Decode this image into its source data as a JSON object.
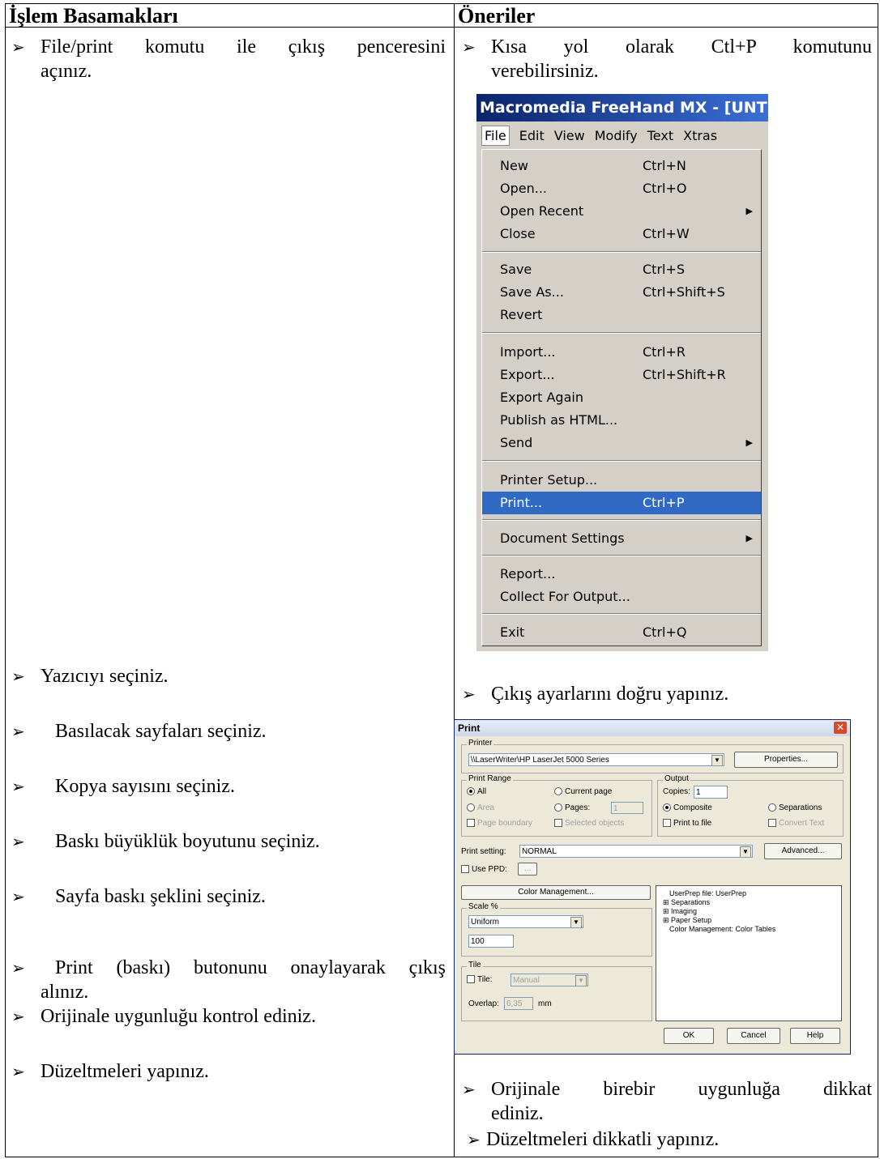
{
  "headers": {
    "left": "İşlem Basamakları",
    "right": "Öneriler"
  },
  "bullet_glyph": "➢",
  "left_steps": [
    {
      "line1": "File/print komutu ile çıkış penceresini",
      "line2": "açınız."
    },
    {
      "line1": "Yazıcıyı seçiniz."
    },
    {
      "line1": "Basılacak sayfaları seçiniz."
    },
    {
      "line1": "Kopya sayısını seçiniz."
    },
    {
      "line1": "Baskı büyüklük boyutunu seçiniz."
    },
    {
      "line1": "Sayfa baskı şeklini seçiniz."
    },
    {
      "line1": "Print (baskı) butonunu onaylayarak çıkış",
      "line2": "alınız."
    },
    {
      "line1": "Orijinale uygunluğu kontrol ediniz."
    },
    {
      "line1": "Düzeltmeleri yapınız."
    }
  ],
  "right_notes": [
    {
      "line1": "Kısa yol olarak Ctl+P komutunu",
      "line2": "verebilirsiniz."
    },
    {
      "line1": "Çıkış ayarlarını doğru yapınız."
    },
    {
      "line1": "Orijinale birebir uygunluğa dikkat",
      "line2": "ediniz."
    },
    {
      "line1": "Düzeltmeleri dikkatli yapınız."
    }
  ],
  "freehand_menu": {
    "window_title": "Macromedia FreeHand MX - [UNTI",
    "menubar": [
      "File",
      "Edit",
      "View",
      "Modify",
      "Text",
      "Xtras"
    ],
    "items": [
      {
        "label": "New",
        "shortcut": "Ctrl+N"
      },
      {
        "label": "Open...",
        "shortcut": "Ctrl+O"
      },
      {
        "label": "Open Recent",
        "shortcut": "",
        "submenu": "▶"
      },
      {
        "label": "Close",
        "shortcut": "Ctrl+W"
      },
      {
        "label": "Save",
        "shortcut": "Ctrl+S"
      },
      {
        "label": "Save As...",
        "shortcut": "Ctrl+Shift+S"
      },
      {
        "label": "Revert",
        "shortcut": ""
      },
      {
        "label": "Import...",
        "shortcut": "Ctrl+R"
      },
      {
        "label": "Export...",
        "shortcut": "Ctrl+Shift+R"
      },
      {
        "label": "Export Again",
        "shortcut": ""
      },
      {
        "label": "Publish as HTML...",
        "shortcut": ""
      },
      {
        "label": "Send",
        "shortcut": "",
        "submenu": "▶"
      },
      {
        "label": "Printer Setup...",
        "shortcut": ""
      },
      {
        "label": "Print...",
        "shortcut": "Ctrl+P",
        "highlighted": true
      },
      {
        "label": "Document Settings",
        "shortcut": "",
        "submenu": "▶"
      },
      {
        "label": "Report...",
        "shortcut": ""
      },
      {
        "label": "Collect For Output...",
        "shortcut": ""
      },
      {
        "label": "Exit",
        "shortcut": "Ctrl+Q"
      }
    ]
  },
  "print_dialog": {
    "title": "Print",
    "close_glyph": "✕",
    "printer_group": "Printer",
    "printer_value": "\\\\LaserWriter\\HP LaserJet 5000 Series",
    "properties_button": "Properties...",
    "print_range_group": "Print Range",
    "range_all": "All",
    "range_current": "Current page",
    "range_area": "Area",
    "range_pages": "Pages:",
    "range_pages_value": "1",
    "page_boundary": "Page boundary",
    "selected_objects": "Selected objects",
    "output_group": "Output",
    "copies_label": "Copies:",
    "copies_value": "1",
    "composite": "Composite",
    "separations": "Separations",
    "print_to_file": "Print to file",
    "convert_text": "Convert Text",
    "print_setting_label": "Print setting:",
    "print_setting_value": "NORMAL",
    "advanced_button": "Advanced...",
    "use_ppd": "Use PPD:",
    "ppd_button": "...",
    "color_management_button": "Color Management...",
    "scale_group": "Scale %",
    "scale_mode": "Uniform",
    "scale_value": "100",
    "tile_group": "Tile",
    "tile_label": "Tile:",
    "tile_value": "Manual",
    "overlap_label": "Overlap:",
    "overlap_value": "6,35",
    "overlap_unit": "mm",
    "tree": [
      "UserPrep file: UserPrep",
      "Separations",
      "Imaging",
      "Paper Setup",
      "Color Management: Color Tables"
    ],
    "ok_button": "OK",
    "cancel_button": "Cancel",
    "help_button": "Help"
  }
}
